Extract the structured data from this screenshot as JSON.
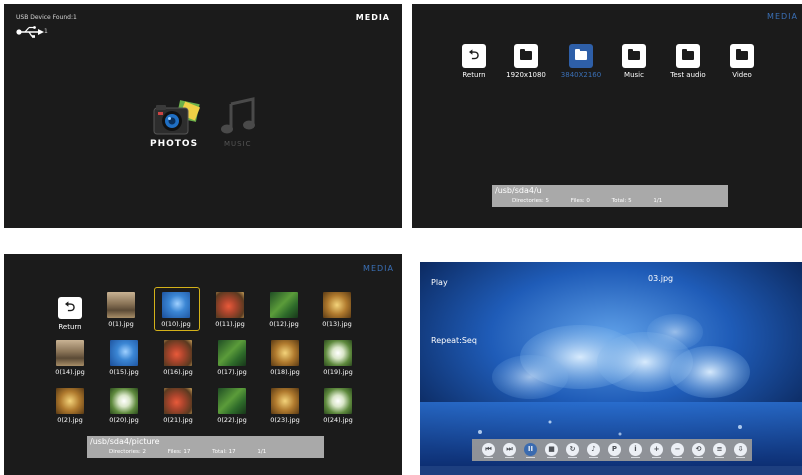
{
  "panel1": {
    "usb_found": "USB Device Found:1",
    "usb_count": "1",
    "media_title": "MEDIA",
    "items": [
      {
        "label": "PHOTOS",
        "icon": "camera-photos-icon"
      },
      {
        "label": "MUSIC",
        "icon": "music-note-icon"
      }
    ]
  },
  "panel2": {
    "media_title": "MEDIA",
    "items": [
      {
        "label": "Return",
        "icon": "return-icon"
      },
      {
        "label": "1920x1080",
        "icon": "folder-icon"
      },
      {
        "label": "3840X2160",
        "icon": "folder-icon",
        "selected": true
      },
      {
        "label": "Music",
        "icon": "folder-icon"
      },
      {
        "label": "Test audio",
        "icon": "folder-icon"
      },
      {
        "label": "Video",
        "icon": "folder-icon"
      }
    ],
    "info": {
      "path": "/usb/sda4/u",
      "directories": "Directories: 5",
      "files": "Files: 0",
      "total": "Total: 5",
      "page": "1/1"
    }
  },
  "panel3": {
    "media_title": "MEDIA",
    "return_label": "Return",
    "rows": [
      [
        "0(1).jpg",
        "0(10).jpg",
        "0(11).jpg",
        "0(12).jpg",
        "0(13).jpg"
      ],
      [
        "0(14).jpg",
        "0(15).jpg",
        "0(16).jpg",
        "0(17).jpg",
        "0(18).jpg",
        "0(19).jpg"
      ],
      [
        "0(2).jpg",
        "0(20).jpg",
        "0(21).jpg",
        "0(22).jpg",
        "0(23).jpg",
        "0(24).jpg"
      ]
    ],
    "info": {
      "path": "/usb/sda4/picture",
      "directories": "Directories: 2",
      "files": "Files: 17",
      "total": "Total: 17",
      "page": "1/1"
    }
  },
  "panel4": {
    "play_label": "Play",
    "file_name": "03.jpg",
    "repeat_label": "Repeat:Seq",
    "controls": [
      {
        "glyph": "⏮",
        "name": "previous-icon"
      },
      {
        "glyph": "⏭",
        "name": "next-icon"
      },
      {
        "glyph": "II",
        "name": "pause-icon",
        "selected": true
      },
      {
        "glyph": "■",
        "name": "stop-icon"
      },
      {
        "glyph": "↻",
        "name": "repeat-icon"
      },
      {
        "glyph": "♪",
        "name": "music-icon"
      },
      {
        "glyph": "P",
        "name": "playlist-icon"
      },
      {
        "glyph": "i",
        "name": "info-icon"
      },
      {
        "glyph": "+",
        "name": "zoom-in-icon"
      },
      {
        "glyph": "−",
        "name": "zoom-out-icon"
      },
      {
        "glyph": "⟲",
        "name": "rotate-icon"
      },
      {
        "glyph": "≡",
        "name": "menu-icon"
      },
      {
        "glyph": "⇩",
        "name": "move-icon"
      }
    ]
  }
}
